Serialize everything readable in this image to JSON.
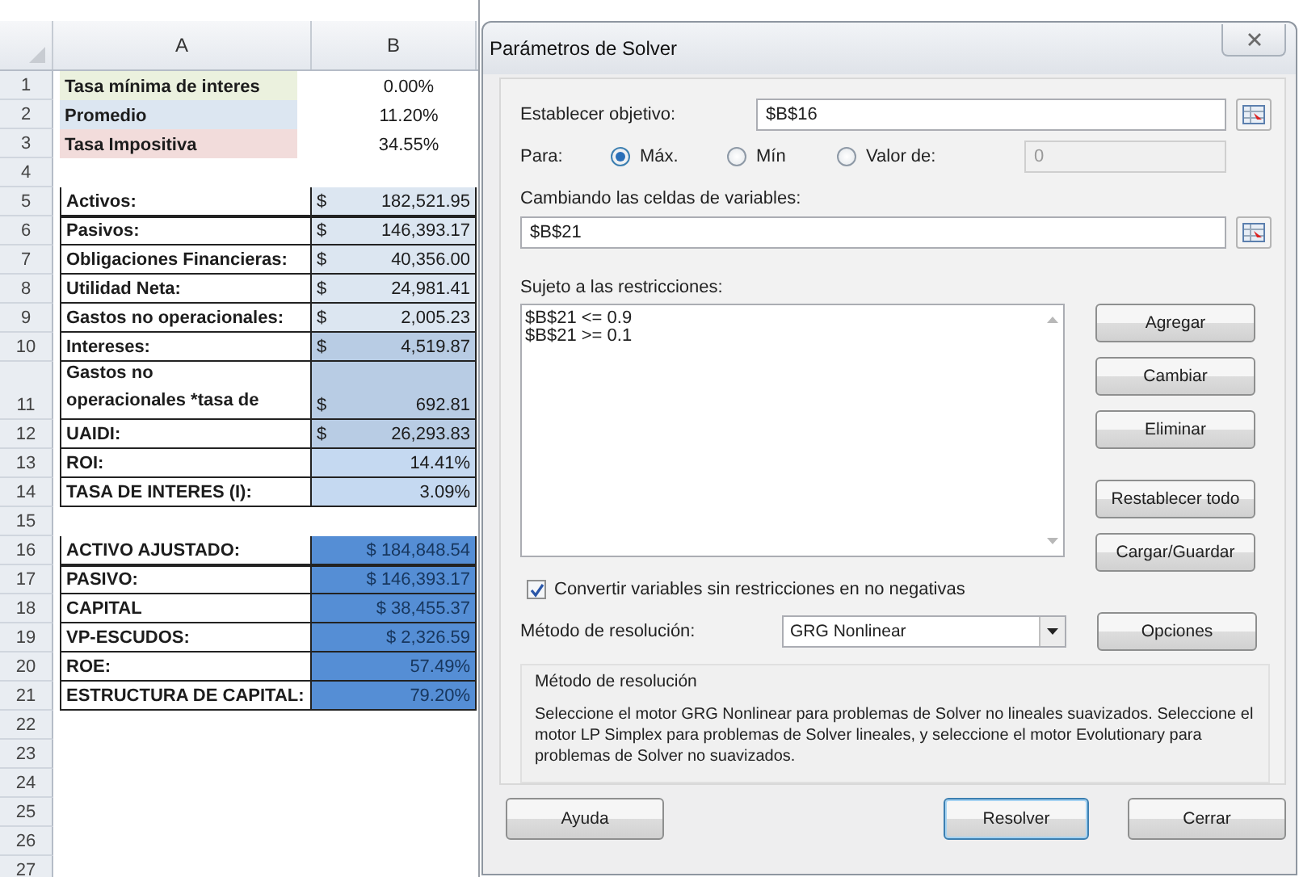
{
  "sheet": {
    "columns": [
      "A",
      "B"
    ],
    "rows": [
      {
        "num": "1",
        "kind": "note",
        "label": "Tasa mínima de interes",
        "color": "#ebf1de",
        "value": "0.00%"
      },
      {
        "num": "2",
        "kind": "note",
        "label": "Promedio",
        "color": "#dce6f1",
        "value": "11.20%"
      },
      {
        "num": "3",
        "kind": "note",
        "label": "Tasa Impositiva",
        "color": "#f2dcdb",
        "value": "34.55%"
      },
      {
        "num": "4",
        "kind": "empty"
      },
      {
        "num": "5",
        "kind": "boxed",
        "label": "Activos:",
        "currency": "$",
        "value": "182,521.95",
        "color": "#dce6f1"
      },
      {
        "num": "6",
        "kind": "boxed",
        "label": "Pasivos:",
        "currency": "$",
        "value": "146,393.17",
        "color": "#dce6f1"
      },
      {
        "num": "7",
        "kind": "boxed",
        "label": "Obligaciones Financieras:",
        "currency": "$",
        "value": "40,356.00",
        "color": "#dce6f1"
      },
      {
        "num": "8",
        "kind": "boxed",
        "label": "Utilidad Neta:",
        "currency": "$",
        "value": "24,981.41",
        "color": "#dce6f1"
      },
      {
        "num": "9",
        "kind": "boxed",
        "label": "Gastos no operacionales:",
        "currency": "$",
        "value": "2,005.23",
        "color": "#dce6f1"
      },
      {
        "num": "10",
        "kind": "boxed",
        "label": "Intereses:",
        "currency": "$",
        "value": "4,519.87",
        "color": "#b8cce4"
      },
      {
        "num": "11",
        "kind": "tall",
        "label_lines": [
          "Gastos no",
          "operacionales *tasa de"
        ],
        "currency": "$",
        "value": "692.81",
        "color": "#b8cce4"
      },
      {
        "num": "12",
        "kind": "boxed",
        "label": "UAIDI:",
        "currency": "$",
        "value": "26,293.83",
        "color": "#b8cce4"
      },
      {
        "num": "13",
        "kind": "boxed",
        "label": "ROI:",
        "value": "14.41%",
        "color": "#c5d9f1"
      },
      {
        "num": "14",
        "kind": "boxed",
        "label": "TASA DE INTERES (I):",
        "value": "3.09%",
        "color": "#c5d9f1"
      },
      {
        "num": "15",
        "kind": "empty"
      },
      {
        "num": "16",
        "kind": "boxed",
        "label": "ACTIVO AJUSTADO:",
        "value": "$ 184,848.54",
        "color": "#558ed5"
      },
      {
        "num": "17",
        "kind": "boxed",
        "label": "PASIVO:",
        "value": "$ 146,393.17",
        "color": "#558ed5"
      },
      {
        "num": "18",
        "kind": "boxed",
        "label": "CAPITAL",
        "value": "$ 38,455.37",
        "color": "#558ed5"
      },
      {
        "num": "19",
        "kind": "boxed",
        "label": "VP-ESCUDOS:",
        "value": "$ 2,326.59",
        "color": "#558ed5"
      },
      {
        "num": "20",
        "kind": "boxed",
        "label": "ROE:",
        "value": "57.49%",
        "color": "#558ed5"
      },
      {
        "num": "21",
        "kind": "boxed",
        "label": "ESTRUCTURA DE CAPITAL:",
        "value": "79.20%",
        "color": "#558ed5"
      },
      {
        "num": "22",
        "kind": "empty"
      },
      {
        "num": "23",
        "kind": "empty"
      },
      {
        "num": "24",
        "kind": "empty"
      },
      {
        "num": "25",
        "kind": "empty"
      },
      {
        "num": "26",
        "kind": "empty"
      },
      {
        "num": "27",
        "kind": "empty"
      }
    ]
  },
  "dialog": {
    "title": "Parámetros de Solver",
    "objective": {
      "label": "Establecer objetivo:",
      "value": "$B$16"
    },
    "to": {
      "label": "Para:",
      "options": [
        {
          "label": "Máx.",
          "selected": true
        },
        {
          "label": "Mín",
          "selected": false
        },
        {
          "label": "Valor de:",
          "selected": false
        }
      ],
      "value": "0",
      "disabled": true
    },
    "changing": {
      "label": "Cambiando las celdas de variables:",
      "value": "$B$21"
    },
    "constraints": {
      "label": "Sujeto a las restricciones:",
      "items": [
        "$B$21 <= 0.9",
        "$B$21 >= 0.1"
      ]
    },
    "side_buttons": [
      "Agregar",
      "Cambiar",
      "Eliminar",
      "Restablecer todo",
      "Cargar/Guardar"
    ],
    "nonneg": {
      "label": "Convertir variables sin restricciones en no negativas",
      "checked": true
    },
    "method": {
      "label": "Método de resolución:",
      "value": "GRG Nonlinear",
      "button": "Opciones"
    },
    "description": {
      "title": "Método de resolución",
      "text": "Seleccione el motor GRG Nonlinear para problemas de Solver no lineales suavizados. Seleccione el motor LP Simplex para problemas de Solver lineales, y seleccione el motor Evolutionary para problemas de Solver no suavizados."
    },
    "footer_buttons": [
      {
        "label": "Ayuda",
        "focused": false
      },
      {
        "label": "Resolver",
        "focused": true
      },
      {
        "label": "Cerrar",
        "focused": false
      }
    ]
  }
}
